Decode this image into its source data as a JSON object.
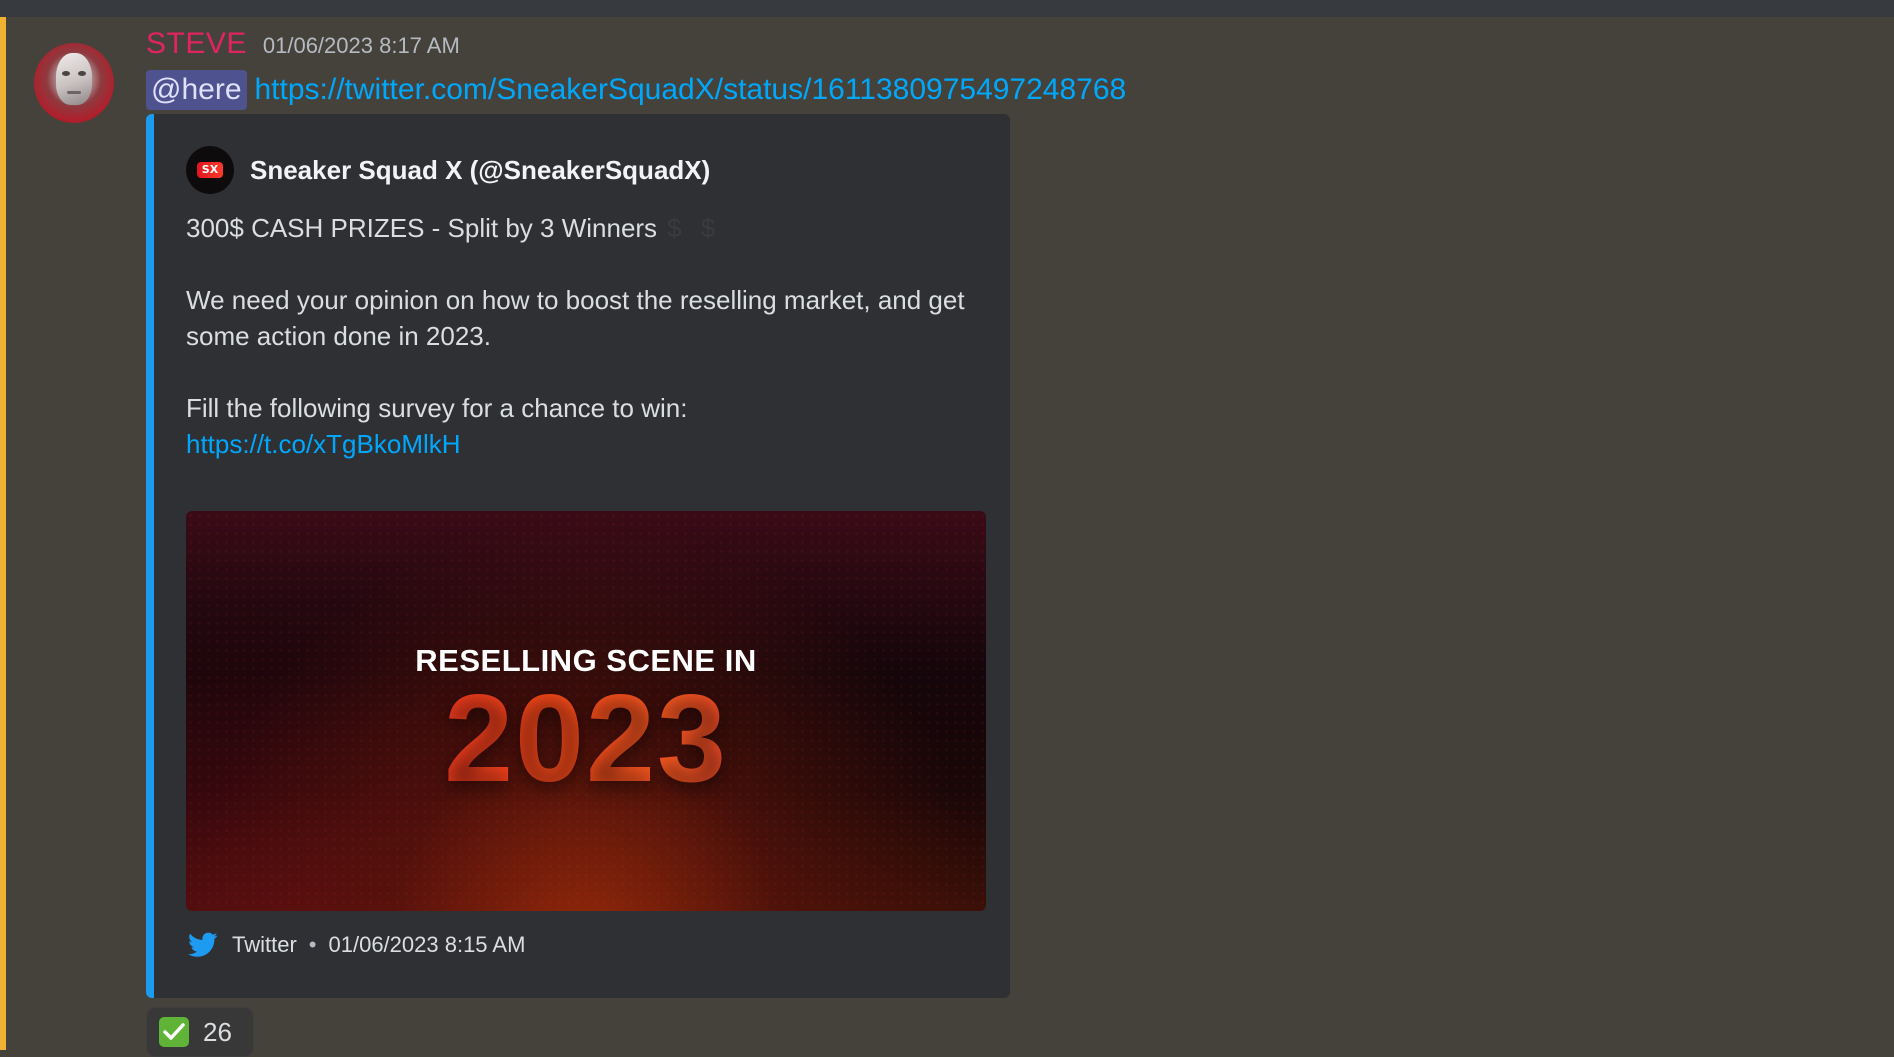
{
  "message": {
    "author": "STEVE",
    "timestamp": "01/06/2023 8:17 AM",
    "mention": "@here",
    "link": "https://twitter.com/SneakerSquadX/status/1611380975497248768"
  },
  "embed": {
    "accent_color": "#1d9bf0",
    "author_name": "Sneaker Squad X (@SneakerSquadX)",
    "description_line1": "300$ CASH PRIZES - Split by 3 Winners",
    "description_dollars": "$ $",
    "description_para2": "We need your opinion on how to boost the reselling market, and get some action done in 2023.",
    "description_para3": "Fill the following survey for a chance to win:",
    "description_link": "https://t.co/xTgBkoMlkH",
    "image": {
      "kicker": "RESELLING SCENE IN",
      "year": "2023"
    },
    "footer": {
      "icon": "twitter-icon",
      "source": "Twitter",
      "separator": "•",
      "timestamp": "01/06/2023 8:15 AM"
    }
  },
  "reaction": {
    "emoji": "white-check-mark-icon",
    "count": "26"
  },
  "colors": {
    "username": "#e0245e",
    "link": "#00a8fc",
    "highlight": "#f0b132",
    "background": "#45423c"
  }
}
